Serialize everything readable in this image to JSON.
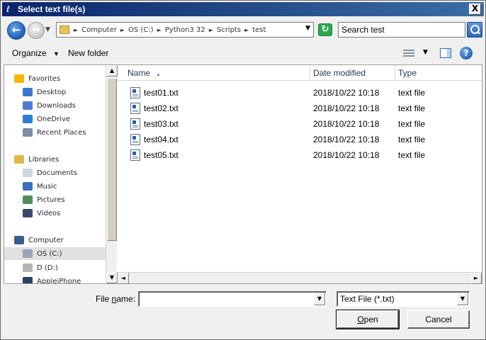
{
  "window": {
    "title": "Select text file(s)",
    "close_label": "X"
  },
  "nav": {
    "breadcrumbs": [
      "Computer",
      "OS (C:)",
      "Python3 32",
      "Scripts",
      "test"
    ],
    "search_placeholder": "Search test"
  },
  "toolbar": {
    "organize": "Organize",
    "new_folder": "New folder"
  },
  "sidebar": {
    "items": [
      {
        "label": "Favorites",
        "icon": "star-icon",
        "color": "#f2b705"
      },
      {
        "label": "Desktop",
        "icon": "desktop-icon",
        "color": "#3a78c9"
      },
      {
        "label": "Downloads",
        "icon": "downloads-icon",
        "color": "#4a7bd1"
      },
      {
        "label": "OneDrive",
        "icon": "cloud-icon",
        "color": "#2b7cd3"
      },
      {
        "label": "Recent Places",
        "icon": "recent-icon",
        "color": "#7b8da8"
      },
      {
        "label": "Libraries",
        "icon": "library-icon",
        "color": "#e3b64d"
      },
      {
        "label": "Documents",
        "icon": "documents-icon",
        "color": "#cfd6e2"
      },
      {
        "label": "Music",
        "icon": "music-icon",
        "color": "#3a6fbf"
      },
      {
        "label": "Pictures",
        "icon": "pictures-icon",
        "color": "#4f8c5a"
      },
      {
        "label": "Videos",
        "icon": "videos-icon",
        "color": "#3b4a66"
      },
      {
        "label": "Computer",
        "icon": "computer-icon",
        "color": "#3c5c8d"
      },
      {
        "label": "OS (C:)",
        "icon": "drive-icon",
        "color": "#9aa6b5"
      },
      {
        "label": "D (D:)",
        "icon": "drive-icon",
        "color": "#b6b6b6"
      },
      {
        "label": "AppleiPhone",
        "icon": "phone-icon",
        "color": "#2a3f66"
      }
    ]
  },
  "columns": {
    "name": "Name",
    "date": "Date modified",
    "type": "Type"
  },
  "files": [
    {
      "name": "test01.txt",
      "date": "2018/10/22 10:18",
      "type": "text file"
    },
    {
      "name": "test02.txt",
      "date": "2018/10/22 10:18",
      "type": "text file"
    },
    {
      "name": "test03.txt",
      "date": "2018/10/22 10:18",
      "type": "text file"
    },
    {
      "name": "test04.txt",
      "date": "2018/10/22 10:18",
      "type": "text file"
    },
    {
      "name": "test05.txt",
      "date": "2018/10/22 10:18",
      "type": "text file"
    }
  ],
  "footer": {
    "filename_label_pre": "File ",
    "filename_label_accel": "n",
    "filename_label_post": "ame:",
    "filename_value": "",
    "filter": "Text File (*.txt)",
    "open_accel": "O",
    "open_rest": "pen",
    "cancel": "Cancel"
  }
}
